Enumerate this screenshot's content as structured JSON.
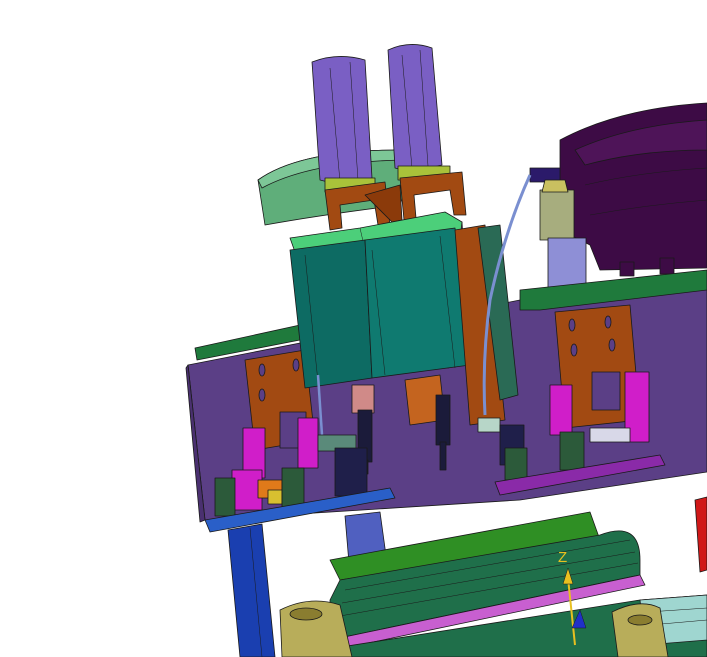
{
  "viewport": {
    "axis_label_z": "Z",
    "colors": {
      "background": "#ffffff",
      "base_plate": "#5b3f86",
      "top_plate": "#1f7a3c",
      "cylinder": "#7a5fc4",
      "motor_body": "#0d6b63",
      "bracket": "#a24a12",
      "magenta_part": "#d01ec9",
      "round_housing": "#5fae7a",
      "dark_cover": "#3d0b45",
      "conveyor": "#1f6f4a",
      "conveyor_top": "#2f8f24",
      "pink_rail": "#c85fd0",
      "end_cap": "#b8ad5a",
      "blue_leg": "#1a3fb0",
      "red_part": "#d01818",
      "axis_z": "#e8c020"
    }
  }
}
